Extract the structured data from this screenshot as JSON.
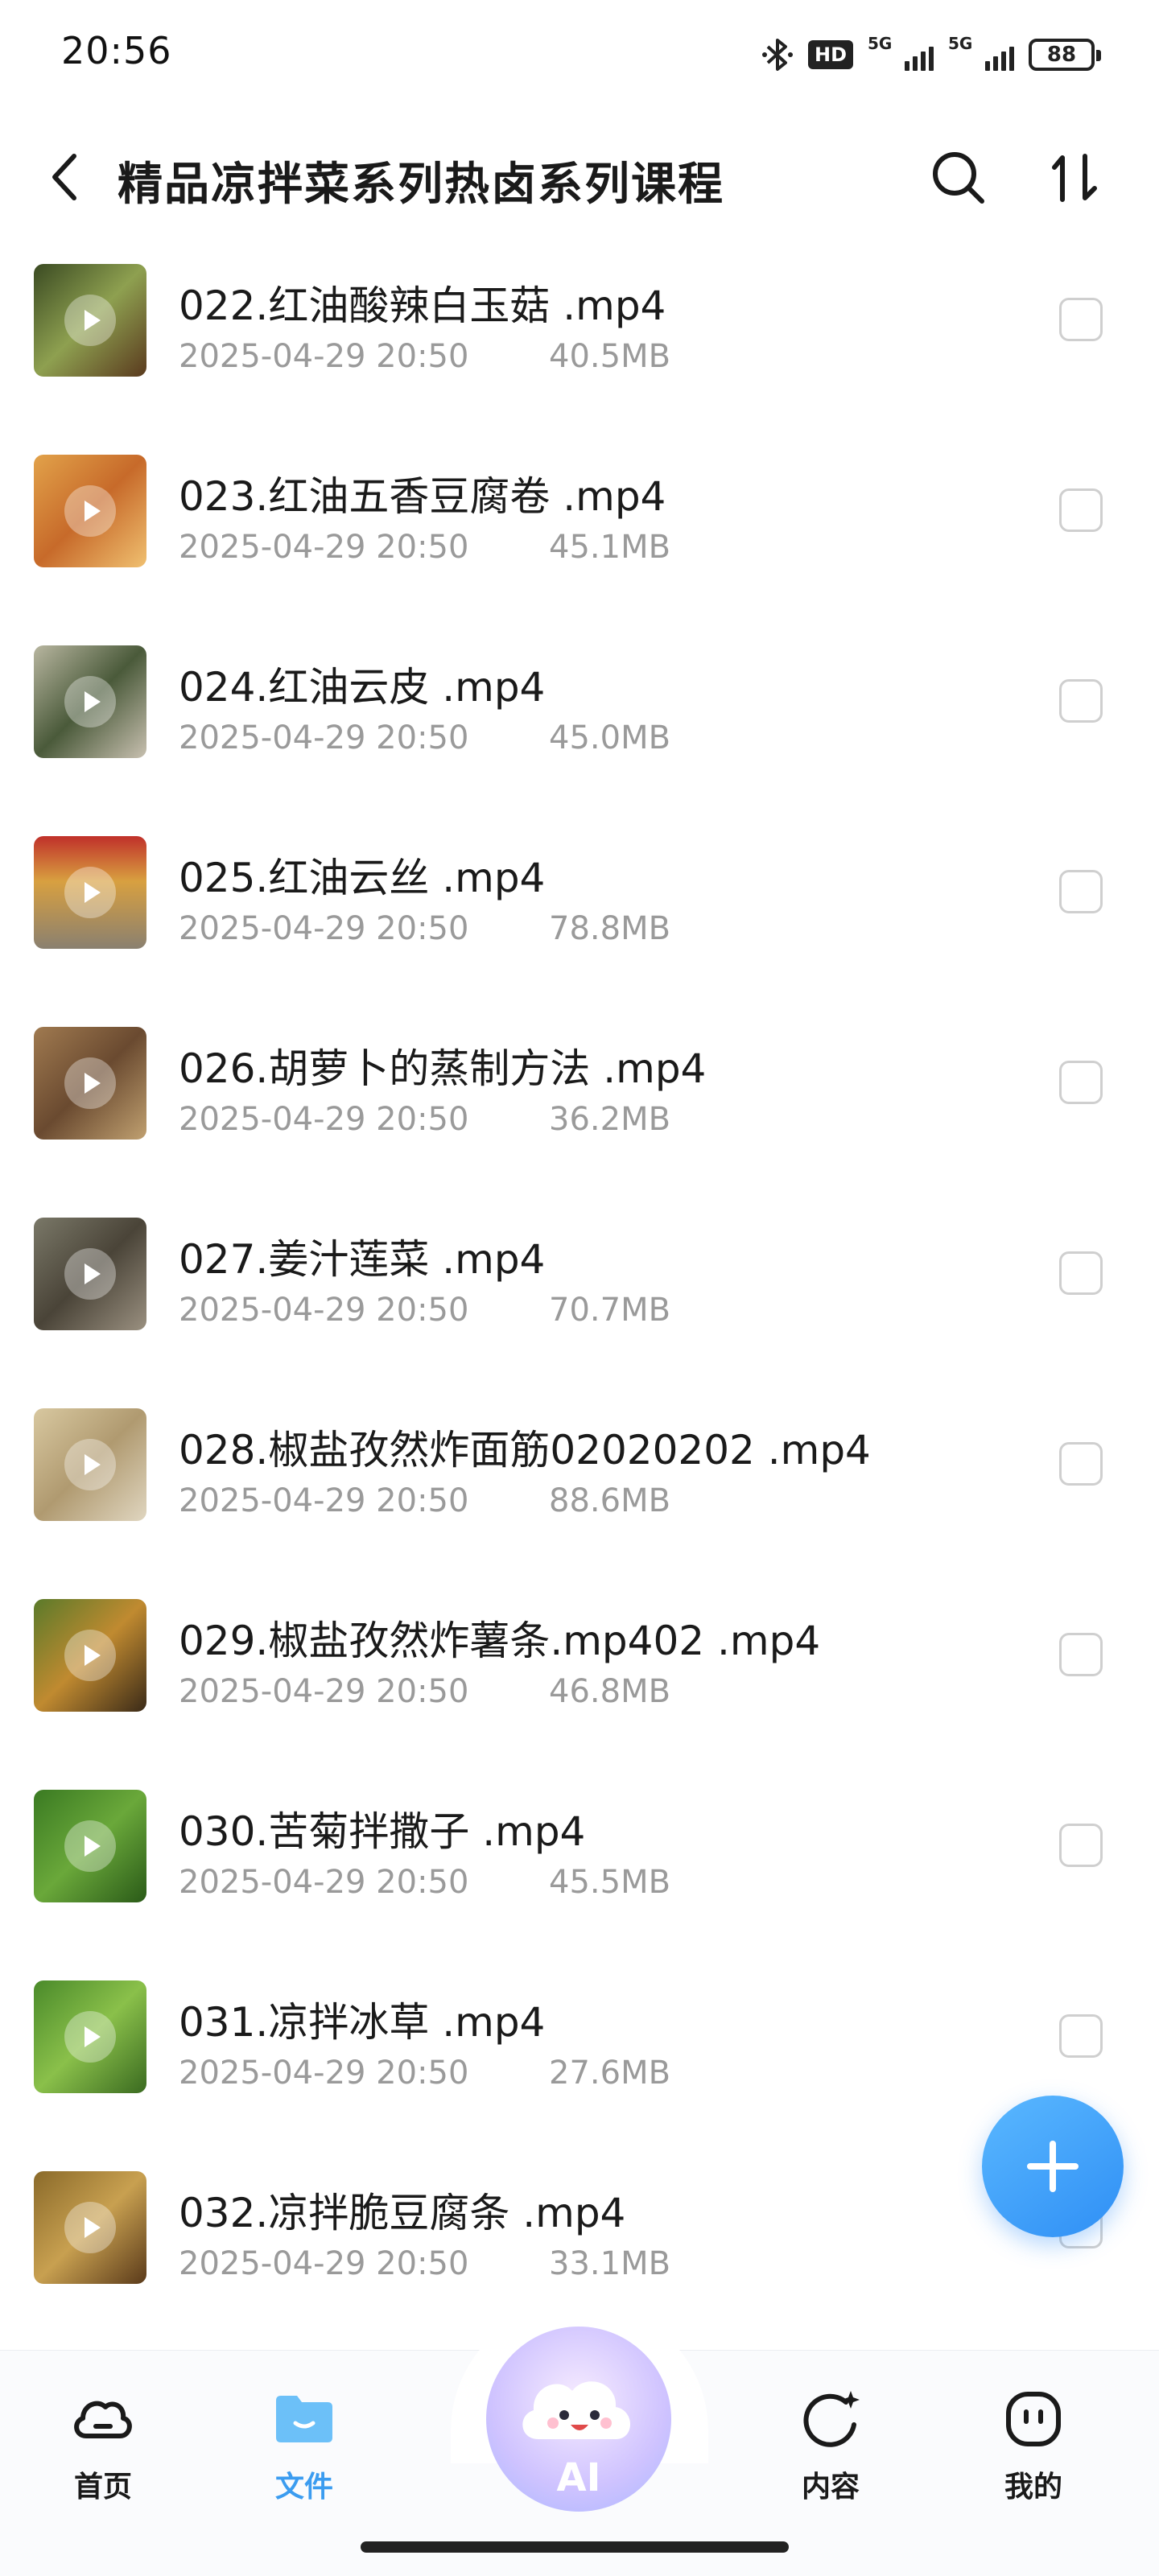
{
  "status_bar": {
    "time": "20:56",
    "hd_label": "HD",
    "net1_label": "5G",
    "net2_label": "5G",
    "battery": "88"
  },
  "header": {
    "title": "精品凉拌菜系列热卤系列课程"
  },
  "files": [
    {
      "name": "022.红油酸辣白玉菇 .mp4",
      "date": "2025-04-29 20:50",
      "size": "40.5MB",
      "thumb_color": "#6b7a3a"
    },
    {
      "name": "023.红油五香豆腐卷 .mp4",
      "date": "2025-04-29 20:50",
      "size": "45.1MB",
      "thumb_color": "#c98a3a"
    },
    {
      "name": "024.红油云皮 .mp4",
      "date": "2025-04-29 20:50",
      "size": "45.0MB",
      "thumb_color": "#8a8f7a"
    },
    {
      "name": "025.红油云丝 .mp4",
      "date": "2025-04-29 20:50",
      "size": "78.8MB",
      "thumb_color": "#b83a2e"
    },
    {
      "name": "026.胡萝卜的蒸制方法 .mp4",
      "date": "2025-04-29 20:50",
      "size": "36.2MB",
      "thumb_color": "#8e6a44"
    },
    {
      "name": "027.姜汁莲菜 .mp4",
      "date": "2025-04-29 20:50",
      "size": "70.7MB",
      "thumb_color": "#6f6a5e"
    },
    {
      "name": "028.椒盐孜然炸面筋02020202 .mp4",
      "date": "2025-04-29 20:50",
      "size": "88.6MB",
      "thumb_color": "#c9b88a"
    },
    {
      "name": "029.椒盐孜然炸薯条.mp402 .mp4",
      "date": "2025-04-29 20:50",
      "size": "46.8MB",
      "thumb_color": "#a06a2a"
    },
    {
      "name": "030.苦菊拌撒子 .mp4",
      "date": "2025-04-29 20:50",
      "size": "45.5MB",
      "thumb_color": "#4f8a2e"
    },
    {
      "name": "031.凉拌冰草 .mp4",
      "date": "2025-04-29 20:50",
      "size": "27.6MB",
      "thumb_color": "#5a8a34"
    },
    {
      "name": "032.凉拌脆豆腐条 .mp4",
      "date": "2025-04-29 20:50",
      "size": "33.1MB",
      "thumb_color": "#8a6a2a"
    }
  ],
  "nav": {
    "home": "首页",
    "files": "文件",
    "ai": "AI",
    "content": "内容",
    "mine": "我的"
  },
  "colors": {
    "accent": "#3b9cf0",
    "fab": "#3a98f5",
    "meta_text": "#9a9a9a"
  }
}
